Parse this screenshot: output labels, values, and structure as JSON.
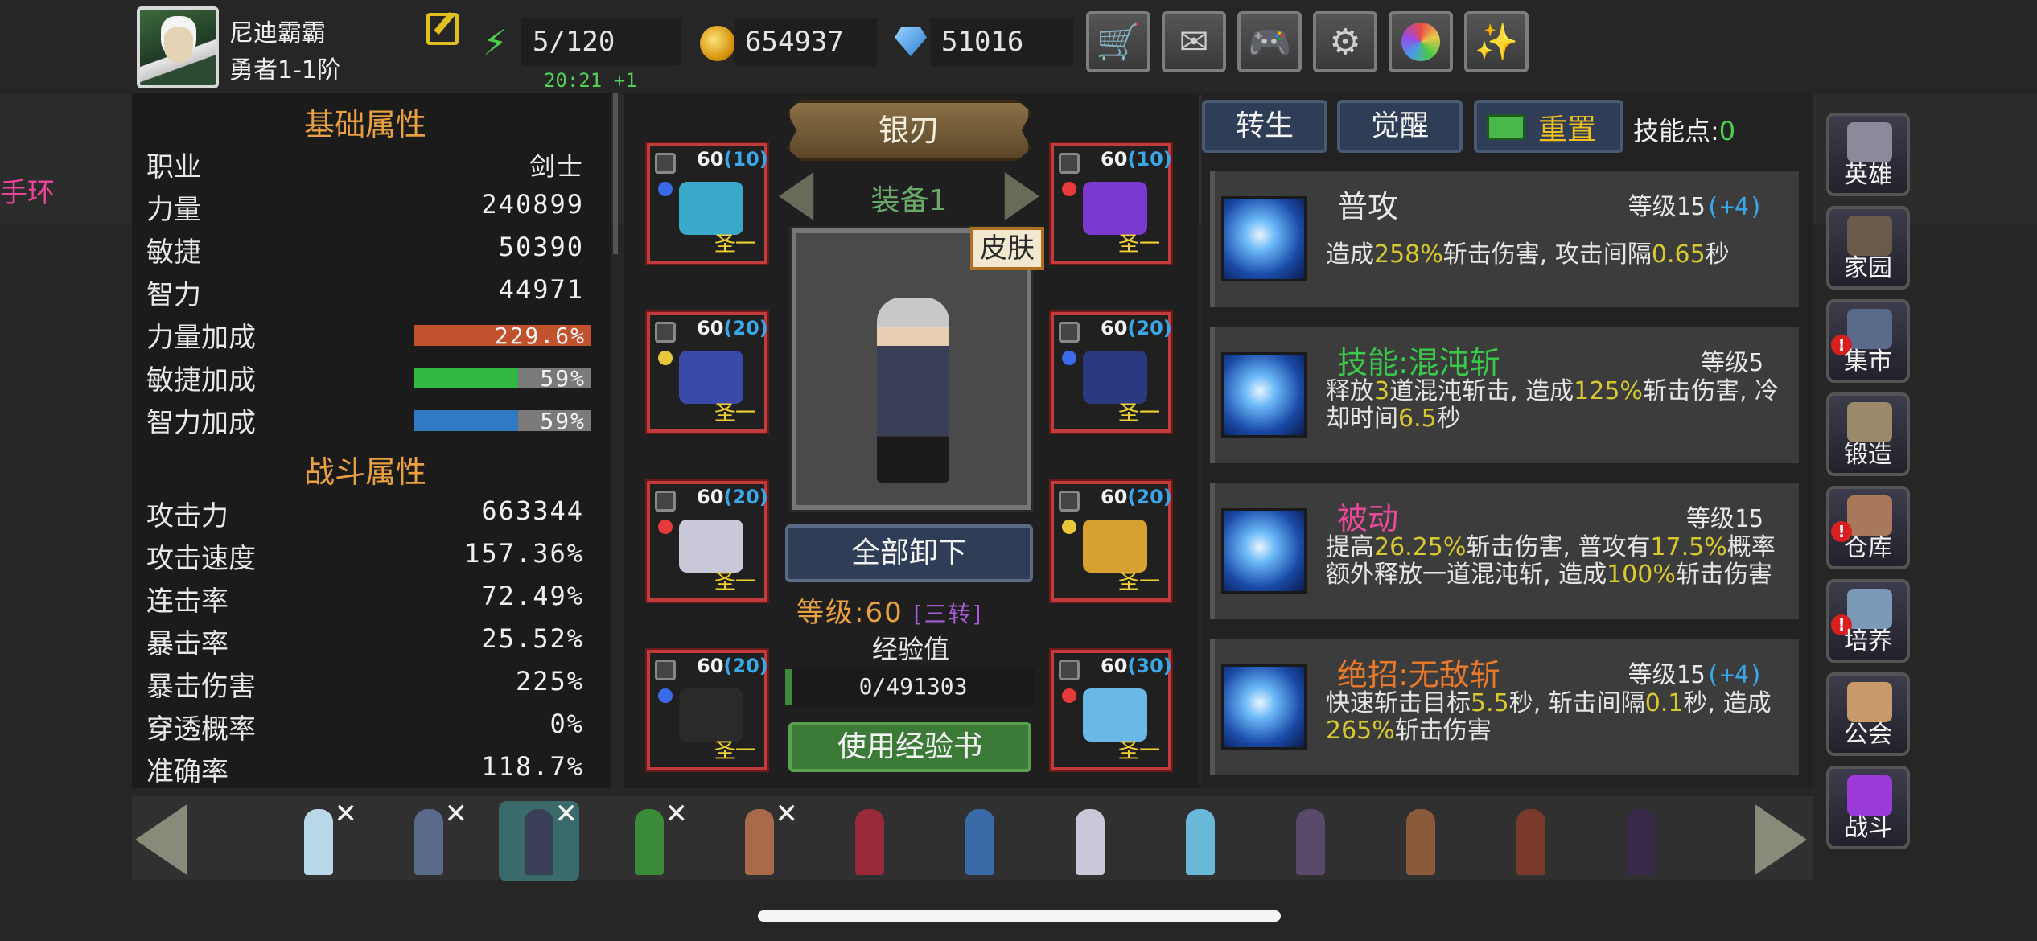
{
  "offscreen_label": "手环",
  "player": {
    "name": "尼迪霸霸",
    "rank": "勇者1-1阶"
  },
  "resources": {
    "energy": "5/120",
    "energy_timer": "20:21 +1",
    "gold": "654937",
    "gems": "51016"
  },
  "top_buttons": [
    "shop-cart-icon",
    "mail-icon",
    "gamepad-icon",
    "gear-icon",
    "aperture-icon",
    "fireworks-icon"
  ],
  "basic_attrs": {
    "title": "基础属性",
    "rows": [
      {
        "label": "职业",
        "value": "剑士"
      },
      {
        "label": "力量",
        "value": "240899"
      },
      {
        "label": "敏捷",
        "value": "50390"
      },
      {
        "label": "智力",
        "value": "44971"
      }
    ],
    "bonuses": [
      {
        "label": "力量加成",
        "value": "229.6%",
        "fill": 1.0,
        "color": "#c2522e"
      },
      {
        "label": "敏捷加成",
        "value": "59%",
        "fill": 0.59,
        "color": "#2fb843"
      },
      {
        "label": "智力加成",
        "value": "59%",
        "fill": 0.59,
        "color": "#2f7ac2"
      }
    ]
  },
  "combat_attrs": {
    "title": "战斗属性",
    "rows": [
      {
        "label": "攻击力",
        "value": "663344"
      },
      {
        "label": "攻击速度",
        "value": "157.36%"
      },
      {
        "label": "连击率",
        "value": "72.49%"
      },
      {
        "label": "暴击率",
        "value": "25.52%"
      },
      {
        "label": "暴击伤害",
        "value": "225%"
      },
      {
        "label": "穿透概率",
        "value": "0%"
      },
      {
        "label": "准确率",
        "value": "118.7%"
      }
    ]
  },
  "equipment": {
    "weapon_name": "银刃",
    "set_label": "装备1",
    "skin_label": "皮肤",
    "unequip_label": "全部卸下",
    "level_label": "等级:60",
    "transfer_label": "[三转]",
    "exp_title": "经验值",
    "exp_value": "0/491303",
    "exp_book_label": "使用经验书",
    "slots": [
      {
        "level": "60",
        "plus": "(10)",
        "grade": "圣一",
        "item_color": "#3aa8c8"
      },
      {
        "level": "60",
        "plus": "(10)",
        "grade": "圣一",
        "item_color": "#7a3ad0"
      },
      {
        "level": "60",
        "plus": "(20)",
        "grade": "圣一",
        "item_color": "#3a4aa8"
      },
      {
        "level": "60",
        "plus": "(20)",
        "grade": "圣一",
        "item_color": "#2a3a80"
      },
      {
        "level": "60",
        "plus": "(20)",
        "grade": "圣一",
        "item_color": "#c8c8d8"
      },
      {
        "level": "60",
        "plus": "(20)",
        "grade": "圣一",
        "item_color": "#d8a030"
      },
      {
        "level": "60",
        "plus": "(20)",
        "grade": "圣一",
        "item_color": "#2a2a2a"
      },
      {
        "level": "60",
        "plus": "(30)",
        "grade": "圣一",
        "item_color": "#6ab8e8"
      }
    ]
  },
  "skills_header": {
    "rebirth": "转生",
    "awaken": "觉醒",
    "reset": "重置",
    "points_label": "技能点:",
    "points_value": "0"
  },
  "skills": [
    {
      "name": "普攻",
      "name_color": "#e8e8e8",
      "level": "等级15",
      "bonus": "(+4)",
      "desc": [
        [
          "造成",
          ""
        ],
        [
          "258%",
          "hl"
        ],
        [
          "斩击伤害, 攻击间隔",
          ""
        ],
        [
          "0.65",
          "hl"
        ],
        [
          "秒",
          ""
        ]
      ]
    },
    {
      "name": "技能:混沌斩",
      "name_color": "#3ac84a",
      "level": "等级5",
      "bonus": "",
      "desc": [
        [
          "释放",
          ""
        ],
        [
          "3",
          "hl"
        ],
        [
          "道混沌斩击, 造成",
          ""
        ],
        [
          "125%",
          "hl"
        ],
        [
          "斩击伤害, 冷却时间",
          ""
        ],
        [
          "6.5",
          "hl"
        ],
        [
          "秒",
          ""
        ]
      ]
    },
    {
      "name": "被动",
      "name_color": "#e84a9a",
      "level": "等级15",
      "bonus": "",
      "desc": [
        [
          "提高",
          ""
        ],
        [
          "26.25%",
          "hl"
        ],
        [
          "斩击伤害, 普攻有",
          ""
        ],
        [
          "17.5%",
          "hl"
        ],
        [
          "概率额外释放一道混沌斩, 造成",
          ""
        ],
        [
          "100%",
          "hl"
        ],
        [
          "斩击伤害",
          ""
        ]
      ]
    },
    {
      "name": "绝招:无敌斩",
      "name_color": "#e8782a",
      "level": "等级15",
      "bonus": "(+4)",
      "desc": [
        [
          "快速斩击目标",
          ""
        ],
        [
          "5.5",
          "hl"
        ],
        [
          "秒, 斩击间隔",
          ""
        ],
        [
          "0.1",
          "hl"
        ],
        [
          "秒, 造成",
          ""
        ],
        [
          "265%",
          "hl"
        ],
        [
          "斩击伤害",
          ""
        ]
      ]
    }
  ],
  "side_menu": [
    {
      "label": "英雄",
      "icon": "helmet-icon",
      "alert": false,
      "color": "#8a8a9a"
    },
    {
      "label": "家园",
      "icon": "castle-icon",
      "alert": false,
      "color": "#6a5a4a"
    },
    {
      "label": "集市",
      "icon": "market-icon",
      "alert": true,
      "color": "#5a6a8a"
    },
    {
      "label": "锻造",
      "icon": "anvil-icon",
      "alert": false,
      "color": "#9a8a6a"
    },
    {
      "label": "仓库",
      "icon": "dwarf-icon",
      "alert": true,
      "color": "#a8785a"
    },
    {
      "label": "培养",
      "icon": "trophy-icon",
      "alert": true,
      "color": "#7a9ab8"
    },
    {
      "label": "公会",
      "icon": "guild-icon",
      "alert": false,
      "color": "#c89a6a"
    },
    {
      "label": "战斗",
      "icon": "portal-icon",
      "alert": false,
      "color": "#9a3ad8"
    }
  ],
  "roster": [
    {
      "color": "#b8d8e8",
      "x": true,
      "selected": false
    },
    {
      "color": "#5a6a8a",
      "x": true,
      "selected": false
    },
    {
      "color": "#3a3f58",
      "x": true,
      "selected": true
    },
    {
      "color": "#3a8a3a",
      "x": true,
      "selected": false
    },
    {
      "color": "#a86a4a",
      "x": true,
      "selected": false
    },
    {
      "color": "#9a2a3a",
      "x": false,
      "selected": false
    },
    {
      "color": "#3a6aa8",
      "x": false,
      "selected": false
    },
    {
      "color": "#c8c8d8",
      "x": false,
      "selected": false
    },
    {
      "color": "#6ab8d8",
      "x": false,
      "selected": false
    },
    {
      "color": "#5a4a6a",
      "x": false,
      "selected": false
    },
    {
      "color": "#8a5a3a",
      "x": false,
      "selected": false
    },
    {
      "color": "#7a3a2a",
      "x": false,
      "selected": false
    },
    {
      "color": "#3a2a4a",
      "x": false,
      "selected": false
    }
  ]
}
